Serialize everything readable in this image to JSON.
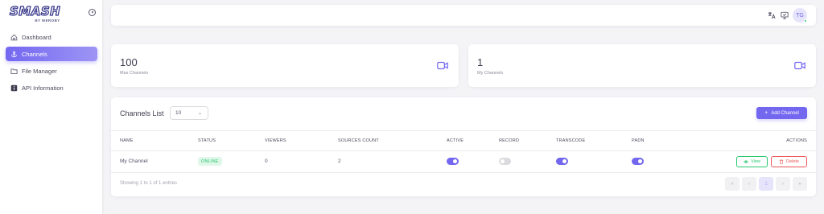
{
  "brand": {
    "name": "SMASH",
    "sub": "BY WEROBY"
  },
  "sidebar": {
    "items": [
      {
        "label": "Dashboard",
        "icon": "home-icon",
        "active": false
      },
      {
        "label": "Channels",
        "icon": "anchor-icon",
        "active": true
      },
      {
        "label": "File Manager",
        "icon": "folder-icon",
        "active": false
      },
      {
        "label": "API Information",
        "icon": "info-icon",
        "active": false
      }
    ]
  },
  "navbar": {
    "icons": [
      "translate-icon",
      "monitor-icon"
    ],
    "avatar_initials": "TG"
  },
  "stats": [
    {
      "value": "100",
      "label": "Max Channels",
      "icon": "video-icon"
    },
    {
      "value": "1",
      "label": "My Channels",
      "icon": "video-icon"
    }
  ],
  "channels": {
    "title": "Channels List",
    "page_size": "10",
    "add_button": "Add Channel",
    "columns": [
      "NAME",
      "STATUS",
      "VIEWERS",
      "SOURCES COUNT",
      "ACTIVE",
      "RECORD",
      "TRANSCODE",
      "PADN",
      "ACTIONS"
    ],
    "rows": [
      {
        "name": "My Channel",
        "status": "ONLINE",
        "viewers": "0",
        "sources_count": "2",
        "active": true,
        "record": false,
        "transcode": true,
        "padn": true,
        "view_label": "View",
        "delete_label": "Delete"
      }
    ],
    "entries_text": "Showing 1 to 1 of 1 entries",
    "pagination": [
      "«",
      "‹",
      "1",
      "›",
      "»"
    ]
  },
  "colors": {
    "accent": "#7367f0",
    "success": "#28c76f",
    "danger": "#ea5455"
  }
}
